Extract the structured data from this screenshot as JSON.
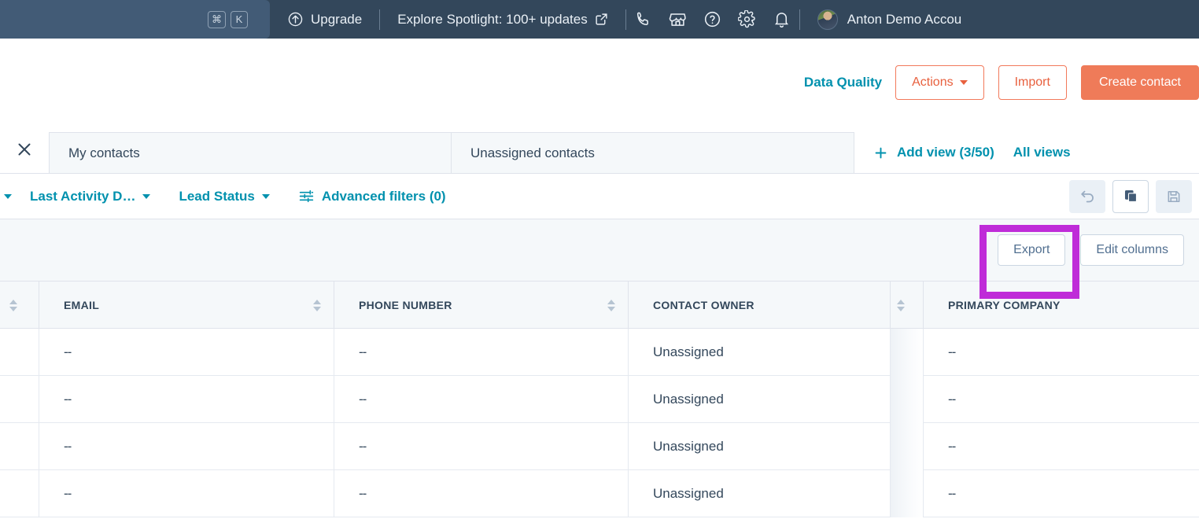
{
  "colors": {
    "nav_bg": "#33475b",
    "search_bg": "#425b76",
    "accent_teal": "#0091ae",
    "accent_orange": "#ef7b59",
    "highlight_purple": "#bf2cd8",
    "table_header_bg": "#f5f8fa",
    "text_dark": "#33475b"
  },
  "topnav": {
    "search_placeholder": "",
    "shortcut_keys": [
      "⌘",
      "K"
    ],
    "upgrade_label": "Upgrade",
    "spotlight_label": "Explore Spotlight: 100+ updates",
    "icons": [
      "phone-icon",
      "marketplace-icon",
      "help-icon",
      "settings-gear-icon",
      "notifications-bell-icon"
    ],
    "account_name": "Anton Demo Accou"
  },
  "actionbar": {
    "data_quality_label": "Data Quality",
    "actions_label": "Actions",
    "import_label": "Import",
    "create_contact_label": "Create contact"
  },
  "views": {
    "tabs": [
      {
        "label": "My contacts"
      },
      {
        "label": "Unassigned contacts"
      }
    ],
    "add_view_label": "Add view (3/50)",
    "all_views_label": "All views"
  },
  "filters": {
    "items": [
      {
        "label": "Last Activity D…"
      },
      {
        "label": "Lead Status"
      }
    ],
    "advanced_label": "Advanced filters (0)",
    "buttons": [
      "undo-icon",
      "clone-icon",
      "save-icon"
    ]
  },
  "toolbar": {
    "export_label": "Export",
    "edit_columns_label": "Edit columns"
  },
  "table": {
    "columns": [
      {
        "key": "pick",
        "label": "",
        "sortable": true
      },
      {
        "key": "email",
        "label": "EMAIL",
        "sortable": true
      },
      {
        "key": "phone",
        "label": "PHONE NUMBER",
        "sortable": true
      },
      {
        "key": "owner",
        "label": "CONTACT OWNER",
        "sortable": false
      },
      {
        "key": "gutter",
        "label": "",
        "sortable": true
      },
      {
        "key": "company",
        "label": "PRIMARY COMPANY",
        "sortable": false
      }
    ],
    "rows": [
      {
        "email": "--",
        "phone": "--",
        "owner": "Unassigned",
        "company": "--"
      },
      {
        "email": "--",
        "phone": "--",
        "owner": "Unassigned",
        "company": "--"
      },
      {
        "email": "--",
        "phone": "--",
        "owner": "Unassigned",
        "company": "--"
      },
      {
        "email": "--",
        "phone": "--",
        "owner": "Unassigned",
        "company": "--"
      }
    ]
  }
}
